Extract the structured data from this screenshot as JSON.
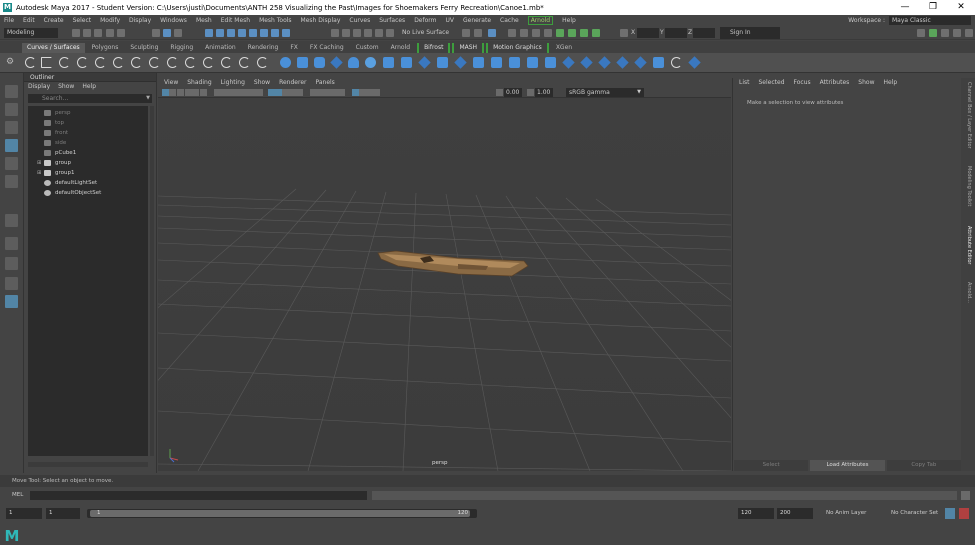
{
  "title": "Autodesk Maya 2017 - Student Version: C:\\Users\\justi\\Documents\\ANTH 258 Visualizing the Past\\Images for Shoemakers Ferry Recreation\\Canoe1.mb*",
  "window_buttons": [
    "—",
    "❐",
    "✕"
  ],
  "menubar": {
    "items": [
      "File",
      "Edit",
      "Create",
      "Select",
      "Modify",
      "Display",
      "Windows",
      "Mesh",
      "Edit Mesh",
      "Mesh Tools",
      "Mesh Display",
      "Curves",
      "Surfaces",
      "Deform",
      "UV",
      "Generate",
      "Cache"
    ],
    "arnold": "Arnold",
    "help": "Help",
    "workspace_label": "Workspace :",
    "workspace_value": "Maya Classic"
  },
  "status_line": {
    "mode": "Modeling",
    "live_surface": "No Live Surface",
    "x_label": "X",
    "y_label": "Y",
    "z_label": "Z",
    "sign_in": "Sign In"
  },
  "shelf_tabs": [
    "Curves / Surfaces",
    "Polygons",
    "Sculpting",
    "Rigging",
    "Animation",
    "Rendering",
    "FX",
    "FX Caching",
    "Custom",
    "Arnold",
    "Bifrost",
    "MASH",
    "Motion Graphics",
    "XGen"
  ],
  "outliner": {
    "title": "Outliner",
    "menu": [
      "Display",
      "Show",
      "Help"
    ],
    "search_placeholder": "Search...",
    "items": [
      {
        "label": "persp",
        "dim": true
      },
      {
        "label": "top",
        "dim": true
      },
      {
        "label": "front",
        "dim": true
      },
      {
        "label": "side",
        "dim": true
      },
      {
        "label": "pCube1",
        "dim": false
      },
      {
        "label": "group",
        "dim": false
      },
      {
        "label": "group1",
        "dim": false
      },
      {
        "label": "defaultLightSet",
        "dim": false
      },
      {
        "label": "defaultObjectSet",
        "dim": false
      }
    ]
  },
  "viewport": {
    "menu": [
      "View",
      "Shading",
      "Lighting",
      "Show",
      "Renderer",
      "Panels"
    ],
    "field_a": "0.00",
    "field_b": "1.00",
    "color_space": "sRGB gamma",
    "camera": "persp"
  },
  "attribute_editor": {
    "menu": [
      "List",
      "Selected",
      "Focus",
      "Attributes",
      "Show",
      "Help"
    ],
    "message": "Make a selection to view attributes",
    "buttons": [
      "Select",
      "Load Attributes",
      "Copy Tab"
    ]
  },
  "side_tabs": [
    "Channel Box / Layer Editor",
    "Modeling Toolkit",
    "Attribute Editor",
    "Arnold..."
  ],
  "help_line": "Move Tool: Select an object to move.",
  "command_line": {
    "label": "MEL"
  },
  "timeline": {
    "start": "1",
    "current": "1",
    "range_start": "1",
    "range_end": "120",
    "end": "120",
    "anim_end": "200",
    "anim_layer": "No Anim Layer",
    "char_set": "No Character Set"
  }
}
